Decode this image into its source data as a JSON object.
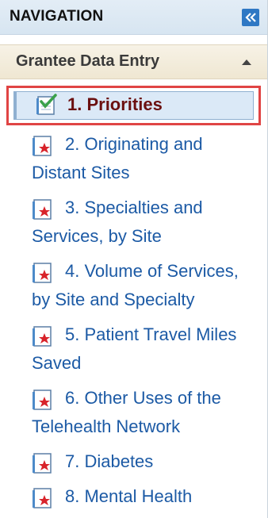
{
  "header": {
    "title": "NAVIGATION",
    "collapse_icon": "double-chevron-left-icon"
  },
  "section": {
    "title": "Grantee Data Entry",
    "expanded": true
  },
  "items": [
    {
      "label": "1. Priorities",
      "icon": "checked-document-icon",
      "selected": true
    },
    {
      "label": "2. Originating and Distant Sites",
      "icon": "document-star-icon",
      "selected": false
    },
    {
      "label": "3. Specialties and Services, by Site",
      "icon": "document-star-icon",
      "selected": false
    },
    {
      "label": "4. Volume of Services, by Site and Specialty",
      "icon": "document-star-icon",
      "selected": false
    },
    {
      "label": "5. Patient Travel Miles Saved",
      "icon": "document-star-icon",
      "selected": false
    },
    {
      "label": "6. Other Uses of the Telehealth Network",
      "icon": "document-star-icon",
      "selected": false
    },
    {
      "label": "7. Diabetes",
      "icon": "document-star-icon",
      "selected": false
    },
    {
      "label": "8. Mental Health",
      "icon": "document-star-icon",
      "selected": false
    }
  ],
  "colors": {
    "link": "#1c5aa5",
    "selected_text": "#6b1010",
    "highlight_border": "#e04444",
    "header_bg": "#dce8f3",
    "section_bg": "#f3ecda"
  }
}
